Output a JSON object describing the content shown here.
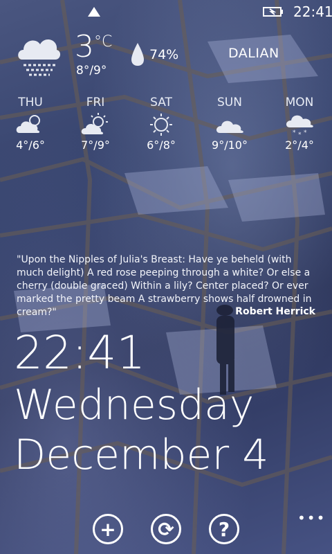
{
  "status": {
    "clock": "22:41"
  },
  "current": {
    "temp": "3",
    "unit": "°C",
    "range": "8°/9°",
    "humidity": "74%",
    "city": "DALIAN",
    "icon": "cloud-fog-icon"
  },
  "forecast": [
    {
      "day": "THU",
      "range": "4°/6°",
      "icon": "partly-cloudy-icon"
    },
    {
      "day": "FRI",
      "range": "7°/9°",
      "icon": "sun-cloud-icon"
    },
    {
      "day": "SAT",
      "range": "6°/8°",
      "icon": "sun-icon"
    },
    {
      "day": "SUN",
      "range": "9°/10°",
      "icon": "cloud-icon"
    },
    {
      "day": "MON",
      "range": "2°/4°",
      "icon": "snow-cloud-icon"
    }
  ],
  "quote": {
    "text": "\"Upon the Nipples of Julia's Breast:  Have ye beheld (with much delight) A red rose peeping through a white? Or else a cherry (double graced) Within a lily?  Center placed? Or ever marked the pretty beam A strawberry shows half drowned in cream?\"",
    "author": "Robert Herrick"
  },
  "lock": {
    "time": "22:41",
    "weekday": "Wednesday",
    "date": "December 4"
  },
  "appbar": {
    "buttons": [
      {
        "name": "add-button",
        "glyph": "+"
      },
      {
        "name": "refresh-button",
        "glyph": "⟳"
      },
      {
        "name": "help-button",
        "glyph": "?"
      }
    ],
    "more": "•••"
  }
}
